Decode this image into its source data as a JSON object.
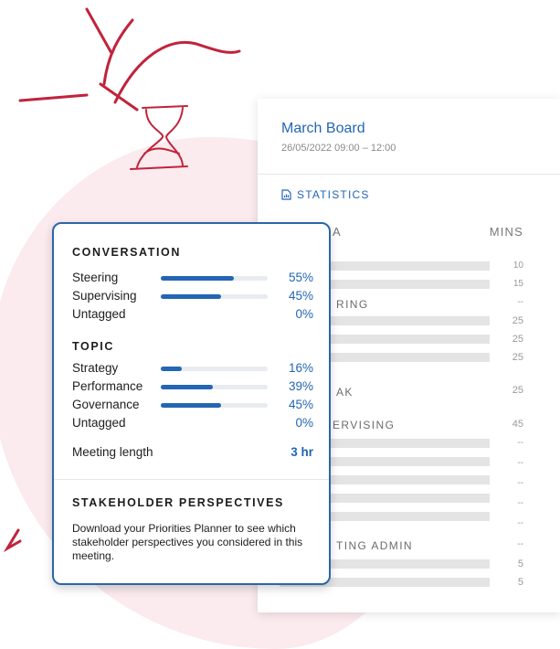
{
  "meeting": {
    "title": "March Board",
    "time": "26/05/2022  09:00 – 12:00"
  },
  "statistics": {
    "heading": "STATISTICS",
    "agenda_header": "A",
    "mins_header": "MINS",
    "sections": [
      {
        "label": "RING"
      },
      {
        "label": "AK"
      },
      {
        "label": "ERVISING"
      },
      {
        "label": "TING ADMIN"
      }
    ],
    "mins": [
      "10",
      "15",
      "--",
      "25",
      "25",
      "25",
      "25",
      "45",
      "--",
      "--",
      "--",
      "--",
      "--",
      "--",
      "5",
      "5"
    ]
  },
  "conversation": {
    "title": "CONVERSATION",
    "items": [
      {
        "label": "Steering",
        "percent": 55,
        "value": "55%"
      },
      {
        "label": "Supervising",
        "percent": 45,
        "value": "45%"
      },
      {
        "label": "Untagged",
        "percent": 0,
        "value": "0%"
      }
    ]
  },
  "topic": {
    "title": "TOPIC",
    "items": [
      {
        "label": "Strategy",
        "percent": 16,
        "value": "16%"
      },
      {
        "label": "Performance",
        "percent": 39,
        "value": "39%"
      },
      {
        "label": "Governance",
        "percent": 45,
        "value": "45%"
      },
      {
        "label": "Untagged",
        "percent": 0,
        "value": "0%"
      }
    ]
  },
  "meeting_length": {
    "label": "Meeting length",
    "value": "3 hr"
  },
  "stakeholder": {
    "title": "STAKEHOLDER PERSPECTIVES",
    "description": "Download your Priorities Planner to see which stakeholder perspectives you considered in this meeting."
  },
  "colors": {
    "accent": "#2366b3",
    "blob": "#fbeaee",
    "sketch": "#c0243c"
  }
}
